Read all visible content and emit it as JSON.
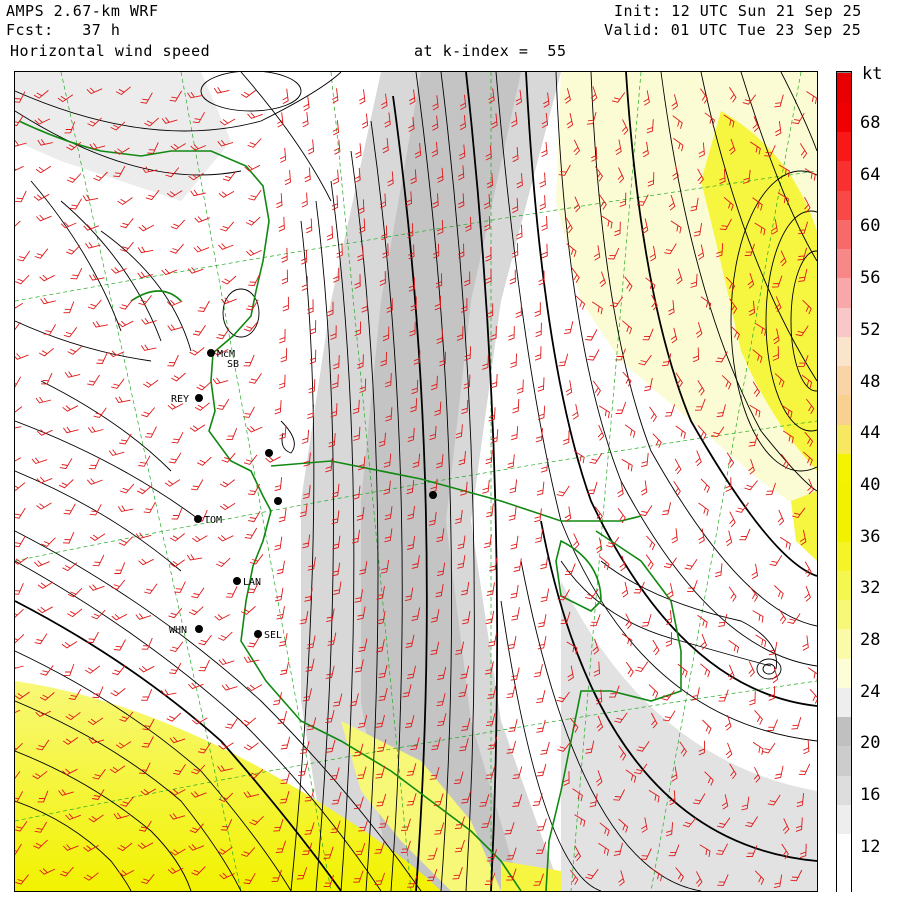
{
  "header": {
    "model": "AMPS 2.67-km WRF",
    "forecast": "Fcst:   37 h",
    "field": "Horizontal wind speed",
    "level": "at k-index =  55",
    "init": "Init: 12 UTC Sun 21 Sep 25",
    "valid": "Valid: 01 UTC Tue 23 Sep 25"
  },
  "colorbar": {
    "unit": "kt",
    "tick_labels": [
      "68",
      "64",
      "60",
      "56",
      "52",
      "48",
      "44",
      "40",
      "36",
      "32",
      "28",
      "24",
      "20",
      "16",
      "12"
    ],
    "colors_bottom_to_top": [
      "#ffffff",
      "#ffffff",
      "#eeeeee",
      "#dddddd",
      "#cccccc",
      "#c0c0c0",
      "#eeeeee",
      "#fdfdd8",
      "#fafaa8",
      "#f8f878",
      "#f6f650",
      "#f4f428",
      "#f2f200",
      "#f2f200",
      "#f4f400",
      "#f6e860",
      "#f8d090",
      "#f8d4a8",
      "#fbe4cc",
      "#f8c8c8",
      "#f8a8a8",
      "#f88888",
      "#f86a6a",
      "#f84848",
      "#f83030",
      "#f81818",
      "#f00000",
      "#e80000"
    ],
    "colors_note_removed": ""
  },
  "stations": [
    {
      "id": "stn-mcm",
      "label": "McM"
    },
    {
      "id": "stn-sb",
      "label": "SB"
    },
    {
      "id": "stn-rey",
      "label": "REY"
    },
    {
      "id": "stn-tom",
      "label": "TOM"
    },
    {
      "id": "stn-lan",
      "label": "LAN"
    },
    {
      "id": "stn-whn",
      "label": "WHN"
    },
    {
      "id": "stn-sel",
      "label": "SEL"
    }
  ],
  "map_colors": {
    "coastline": "#118811",
    "barbs": "#e01818",
    "streamlines": "#000000",
    "graticule": "#22aa22"
  }
}
